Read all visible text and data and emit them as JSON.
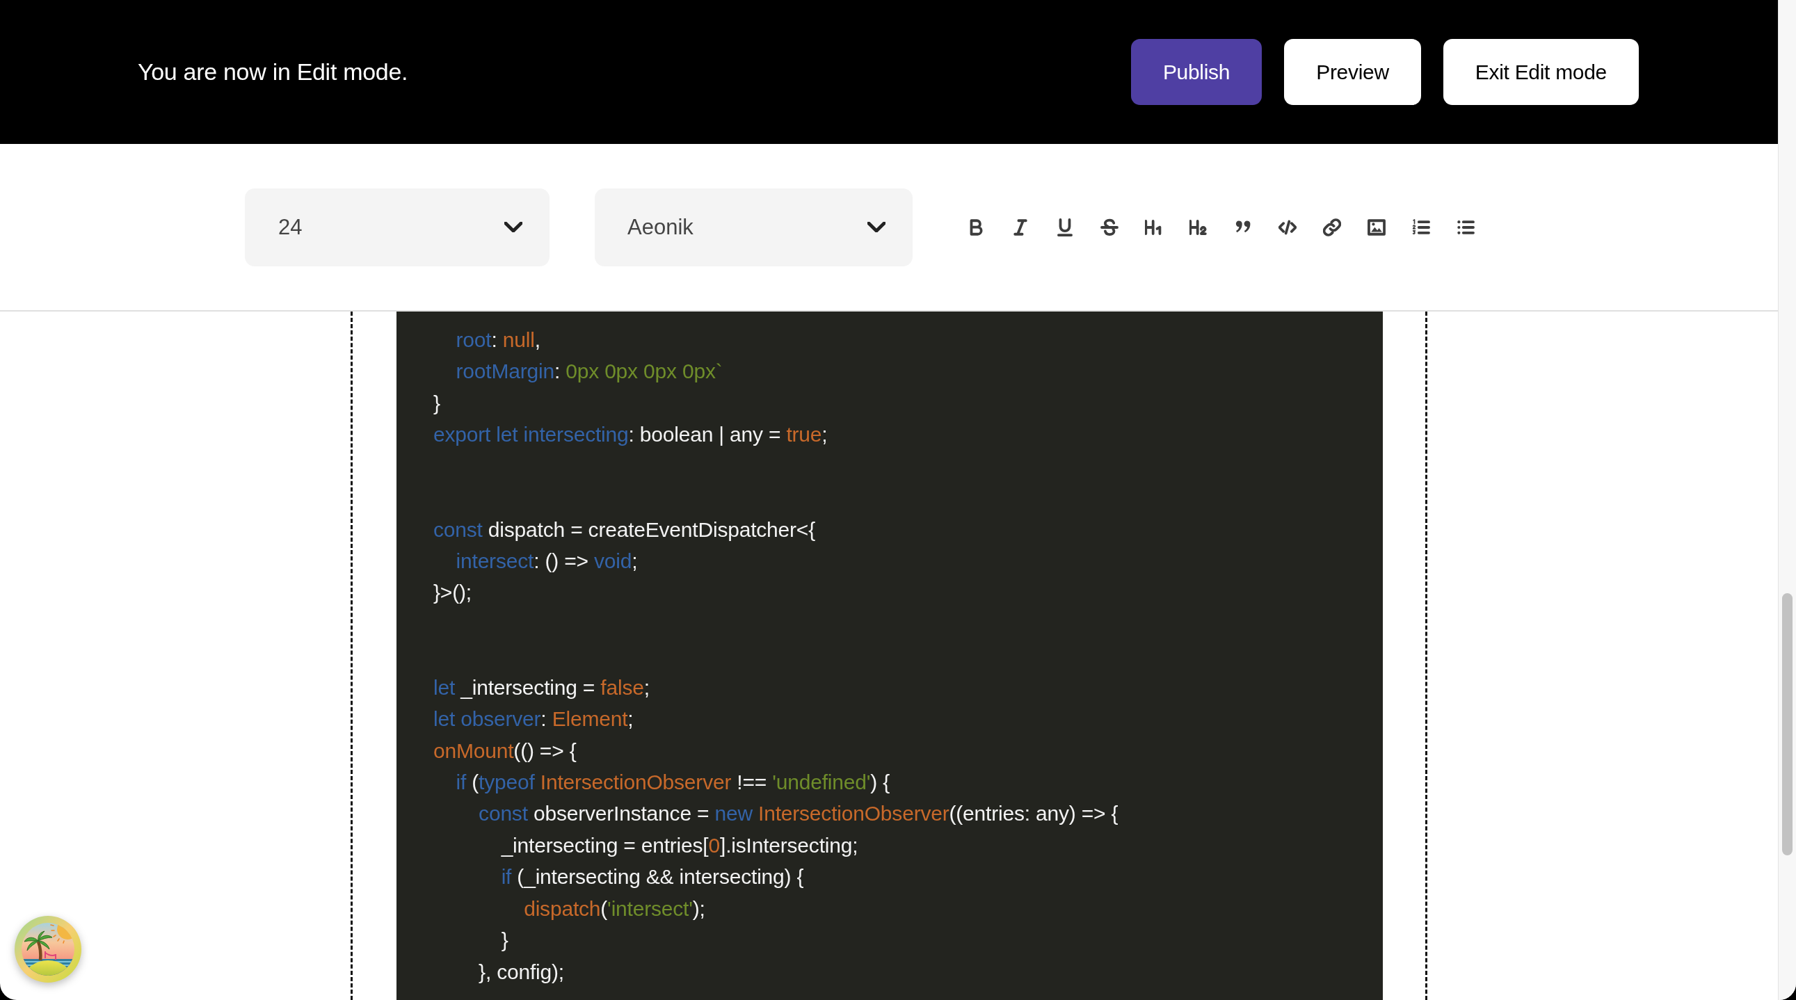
{
  "edit_banner": {
    "message": "You are now in Edit mode.",
    "buttons": [
      {
        "label": "Publish",
        "kind": "primary"
      },
      {
        "label": "Preview",
        "kind": "secondary"
      },
      {
        "label": "Exit Edit mode",
        "kind": "secondary"
      }
    ]
  },
  "toolbar": {
    "font_size": {
      "value": "24"
    },
    "font_family": {
      "value": "Aeonik"
    }
  },
  "code_block": {
    "groups": [
      {
        "lines": [
          {
            "tokens": [
              {
                "kind": "keyword",
                "text": "    root"
              },
              {
                "kind": "plain",
                "text": ": "
              },
              {
                "kind": "value",
                "text": "null"
              },
              {
                "kind": "plain",
                "text": ","
              }
            ]
          },
          {
            "tokens": [
              {
                "kind": "keyword",
                "text": "    rootMargin"
              },
              {
                "kind": "plain",
                "text": ": "
              },
              {
                "kind": "string",
                "text": "0px 0px 0px 0px`"
              }
            ]
          },
          {
            "tokens": [
              {
                "kind": "plain",
                "text": "}"
              }
            ]
          },
          {
            "tokens": [
              {
                "kind": "keyword",
                "text": "export let intersecting"
              },
              {
                "kind": "plain",
                "text": ": boolean | any = "
              },
              {
                "kind": "value",
                "text": "true"
              },
              {
                "kind": "plain",
                "text": ";"
              }
            ]
          }
        ]
      },
      {
        "lines": [
          {
            "tokens": [
              {
                "kind": "keyword",
                "text": "const"
              },
              {
                "kind": "plain",
                "text": " dispatch = createEventDispatcher<{"
              }
            ]
          },
          {
            "tokens": [
              {
                "kind": "keyword",
                "text": "    intersect"
              },
              {
                "kind": "plain",
                "text": ": () => "
              },
              {
                "kind": "keyword",
                "text": "void"
              },
              {
                "kind": "plain",
                "text": ";"
              }
            ]
          },
          {
            "tokens": [
              {
                "kind": "plain",
                "text": "}>();"
              }
            ]
          }
        ]
      },
      {
        "lines": [
          {
            "tokens": [
              {
                "kind": "keyword",
                "text": "let"
              },
              {
                "kind": "plain",
                "text": " _intersecting = "
              },
              {
                "kind": "value",
                "text": "false"
              },
              {
                "kind": "plain",
                "text": ";"
              }
            ]
          },
          {
            "tokens": [
              {
                "kind": "keyword",
                "text": "let observer"
              },
              {
                "kind": "plain",
                "text": ": "
              },
              {
                "kind": "value",
                "text": "Element"
              },
              {
                "kind": "plain",
                "text": ";"
              }
            ]
          },
          {
            "tokens": [
              {
                "kind": "value",
                "text": "onMount"
              },
              {
                "kind": "plain",
                "text": "(() => {"
              }
            ]
          },
          {
            "tokens": [
              {
                "kind": "keyword",
                "text": "    if"
              },
              {
                "kind": "plain",
                "text": " ("
              },
              {
                "kind": "keyword",
                "text": "typeof"
              },
              {
                "kind": "value",
                "text": " IntersectionObserver"
              },
              {
                "kind": "plain",
                "text": " !== "
              },
              {
                "kind": "string",
                "text": "'undefined'"
              },
              {
                "kind": "plain",
                "text": ") {"
              }
            ]
          },
          {
            "tokens": [
              {
                "kind": "keyword",
                "text": "        const"
              },
              {
                "kind": "plain",
                "text": " observerInstance = "
              },
              {
                "kind": "keyword",
                "text": "new"
              },
              {
                "kind": "value",
                "text": " IntersectionObserver"
              },
              {
                "kind": "plain",
                "text": "((entries: any) => {"
              }
            ]
          },
          {
            "tokens": [
              {
                "kind": "plain",
                "text": "            _intersecting = entries["
              },
              {
                "kind": "value",
                "text": "0"
              },
              {
                "kind": "plain",
                "text": "].isIntersecting;"
              }
            ]
          },
          {
            "tokens": [
              {
                "kind": "keyword",
                "text": "            if"
              },
              {
                "kind": "plain",
                "text": " (_intersecting && intersecting) {"
              }
            ]
          },
          {
            "tokens": [
              {
                "kind": "value",
                "text": "                dispatch"
              },
              {
                "kind": "plain",
                "text": "("
              },
              {
                "kind": "string",
                "text": "'intersect'"
              },
              {
                "kind": "plain",
                "text": ");"
              }
            ]
          },
          {
            "tokens": [
              {
                "kind": "plain",
                "text": "            }"
              }
            ]
          },
          {
            "tokens": [
              {
                "kind": "plain",
                "text": "        }, config);"
              }
            ]
          }
        ]
      }
    ]
  }
}
